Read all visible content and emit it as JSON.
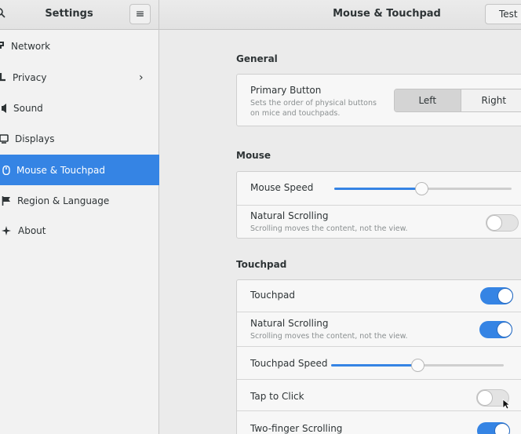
{
  "header": {
    "sidebar_title": "Settings",
    "main_title": "Mouse & Touchpad",
    "test_button": "Test"
  },
  "sidebar": {
    "items": [
      {
        "label": "Network",
        "icon": "network-icon"
      },
      {
        "label": "Privacy",
        "icon": "privacy-icon",
        "has_arrow": true
      },
      {
        "label": "Sound",
        "icon": "sound-icon"
      },
      {
        "label": "Displays",
        "icon": "display-icon"
      },
      {
        "label": "Mouse & Touchpad",
        "icon": "mouse-icon",
        "active": true
      },
      {
        "label": "Region & Language",
        "icon": "flag-icon"
      },
      {
        "label": "About",
        "icon": "star-icon"
      }
    ]
  },
  "general": {
    "title": "General",
    "primary_button": {
      "title": "Primary Button",
      "subtitle_line1": "Sets the order of physical buttons",
      "subtitle_line2": "on mice and touchpads.",
      "options": [
        "Left",
        "Right"
      ],
      "selected": "Left"
    }
  },
  "mouse": {
    "title": "Mouse",
    "speed_label": "Mouse Speed",
    "speed_value": 0.49,
    "natural_scrolling": {
      "title": "Natural Scrolling",
      "subtitle": "Scrolling moves the content, not the view.",
      "on": false
    }
  },
  "touchpad": {
    "title": "Touchpad",
    "touchpad_label": "Touchpad",
    "touchpad_on": true,
    "natural_scrolling": {
      "title": "Natural Scrolling",
      "subtitle": "Scrolling moves the content, not the view.",
      "on": true
    },
    "speed_label": "Touchpad Speed",
    "speed_value": 0.5,
    "tap_to_click": {
      "title": "Tap to Click",
      "on": false
    },
    "two_finger_scrolling": {
      "title": "Two-finger Scrolling",
      "on": true
    }
  },
  "colors": {
    "accent": "#3584e4",
    "sidebar_bg": "#f2f2f2",
    "content_bg": "#ebebeb"
  }
}
